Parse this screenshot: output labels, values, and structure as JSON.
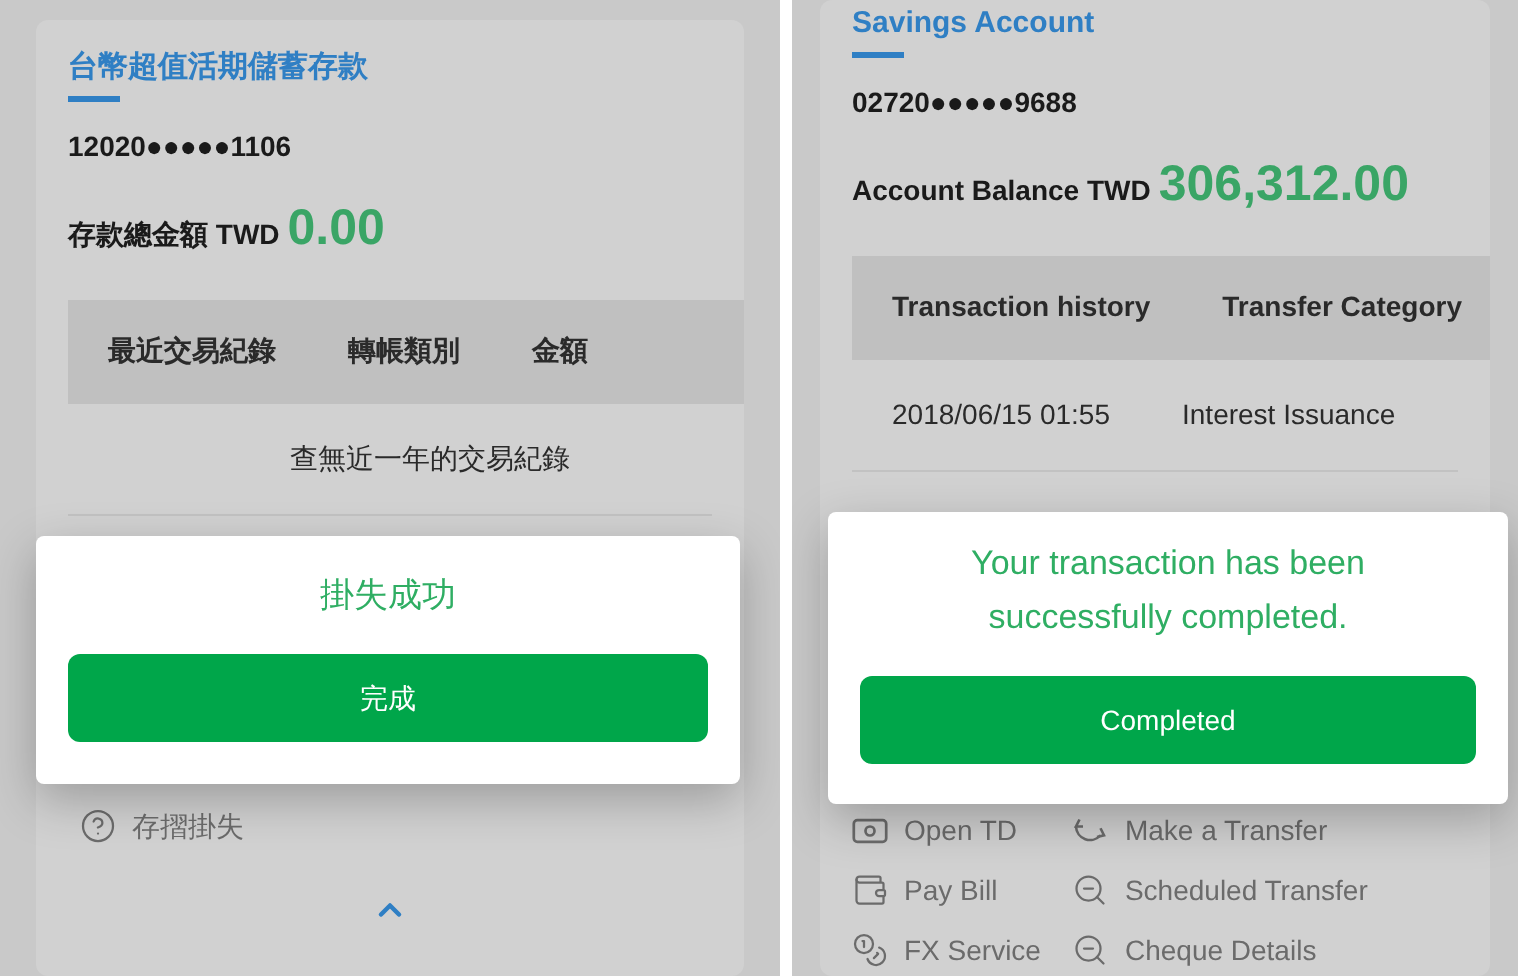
{
  "screens": [
    {
      "section_title": "台幣超值活期儲蓄存款",
      "account_number": "12020●●●●●1106",
      "balance_label": "存款總金額 TWD",
      "balance_value": "0.00",
      "table": {
        "columns": [
          "最近交易紀錄",
          "轉帳類別",
          "金額"
        ],
        "empty_message": "查無近一年的交易紀錄"
      },
      "dialog": {
        "message": "掛失成功",
        "button": "完成"
      },
      "menu": [
        {
          "label": "存摺掛失",
          "kind": "question"
        }
      ],
      "collapse_toggle": true
    },
    {
      "section_title": "Savings Account",
      "account_number": "02720●●●●●9688",
      "balance_label": "Account Balance TWD",
      "balance_value": "306,312.00",
      "table": {
        "columns": [
          "Transaction history",
          "Transfer Category"
        ],
        "rows": [
          [
            "2018/06/15 01:55",
            "Interest Issuance"
          ]
        ]
      },
      "dialog": {
        "message": "Your transaction has been successfully completed.",
        "button": "Completed"
      },
      "menu": [
        {
          "label": "Open TD",
          "kind": "deposit"
        },
        {
          "label": "Make a Transfer",
          "kind": "transfer"
        },
        {
          "label": "Pay Bill",
          "kind": "wallet"
        },
        {
          "label": "Scheduled Transfer",
          "kind": "search"
        },
        {
          "label": "FX Service",
          "kind": "fx"
        },
        {
          "label": "Cheque Details",
          "kind": "search"
        }
      ]
    }
  ]
}
